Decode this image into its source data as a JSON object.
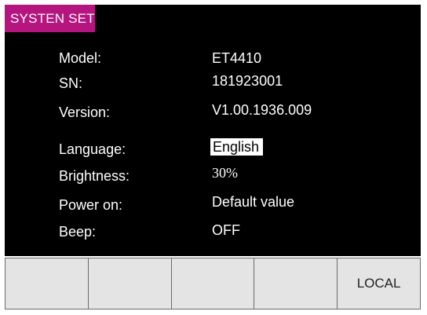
{
  "title": "SYSTEN SET",
  "info": [
    {
      "label": "Model:",
      "value": "ET4410"
    },
    {
      "label": "SN:",
      "value": "181923001"
    },
    {
      "label": "Version:",
      "value": "V1.00.1936.009"
    }
  ],
  "settings": [
    {
      "label": "Language:",
      "value": "English"
    },
    {
      "label": "Brightness:",
      "value": "30%"
    },
    {
      "label": "Power on:",
      "value": "Default value"
    },
    {
      "label": "Beep:",
      "value": "OFF"
    }
  ],
  "softkeys": [
    "",
    "",
    "",
    "",
    "LOCAL"
  ],
  "colors": {
    "screen": "#000000",
    "tab": "#b5157f",
    "softkey": "#e4e4e4"
  }
}
